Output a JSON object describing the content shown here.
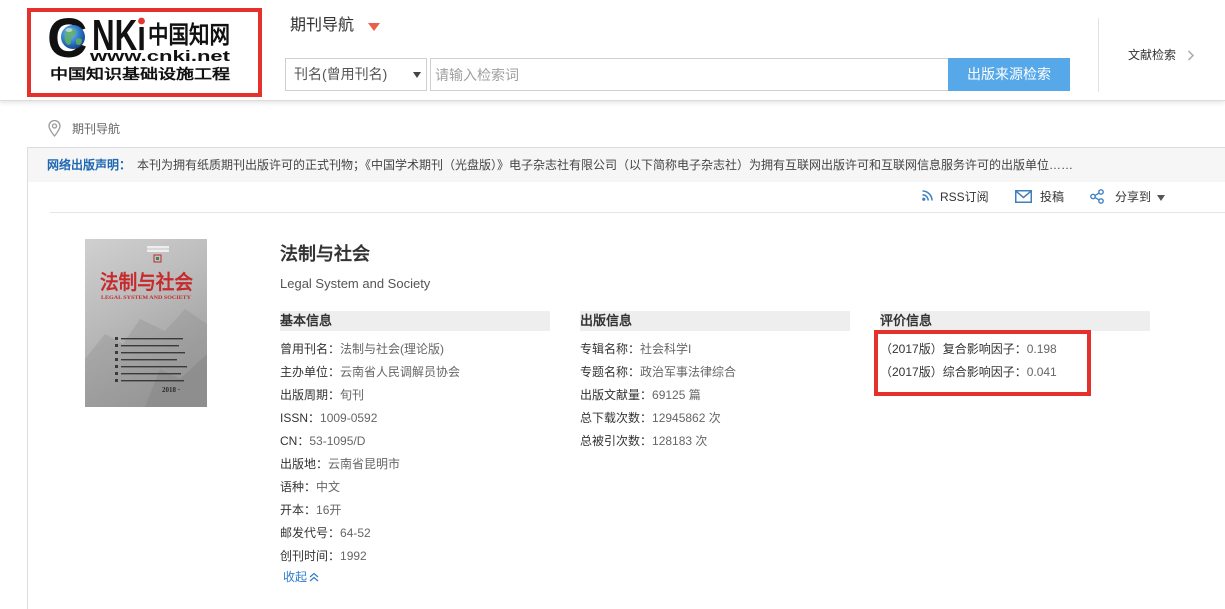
{
  "theme": {
    "search_button_bg": "#57a8e8",
    "highlight_red": "#e4312b",
    "nav_arrow_red": "#ea5f49",
    "notice_label_blue": "#1f68b2",
    "link_blue": "#2d7ccc",
    "icon_blue": "#3f7fc0"
  },
  "header": {
    "logo": {
      "brand_initial": "C",
      "brand_rest": "NKi",
      "brand_cn": "中国知网",
      "url_text": "www.cnki.net",
      "tagline": "中国知识基础设施工程"
    },
    "nav_title": "期刊导航",
    "search": {
      "field_select": "刊名(曾用刊名)",
      "placeholder": "请输入检索词",
      "button": "出版来源检索"
    },
    "right_link": "文献检索"
  },
  "breadcrumb": {
    "current": "期刊导航"
  },
  "notice": {
    "label": "网络出版声明：",
    "text": "本刊为拥有纸质期刊出版许可的正式刊物；《中国学术期刊（光盘版）》电子杂志社有限公司（以下简称电子杂志社）为拥有互联网出版许可和互联网信息服务许可的出版单位……"
  },
  "toolbar": {
    "rss": {
      "label": "RSS订阅",
      "icon": "rss-icon"
    },
    "submit": {
      "label": "投稿",
      "icon": "envelope-icon"
    },
    "share": {
      "label": "分享到",
      "icon": "share-icon"
    }
  },
  "journal": {
    "title": "法制与社会",
    "title_en": "Legal System and Society",
    "cover": {
      "title": "法制与社会",
      "subtitle": "LEGAL SYSTEM AND SOCIETY",
      "issue": "2018 ·"
    }
  },
  "basic_info": {
    "heading": "基本信息",
    "items": [
      {
        "label": "曾用刊名：",
        "value": "法制与社会(理论版)"
      },
      {
        "label": "主办单位：",
        "value": "云南省人民调解员协会"
      },
      {
        "label": "出版周期：",
        "value": "旬刊"
      },
      {
        "label": "ISSN：",
        "value": "1009-0592"
      },
      {
        "label": "CN：",
        "value": "53-1095/D"
      },
      {
        "label": "出版地：",
        "value": "云南省昆明市"
      },
      {
        "label": "语种：",
        "value": "中文"
      },
      {
        "label": "开本：",
        "value": "16开"
      },
      {
        "label": "邮发代号：",
        "value": "64-52"
      },
      {
        "label": "创刊时间：",
        "value": "1992"
      }
    ],
    "collapse_label": "收起"
  },
  "publish_info": {
    "heading": "出版信息",
    "items": [
      {
        "label": "专辑名称：",
        "value": "社会科学I"
      },
      {
        "label": "专题名称：",
        "value": "政治军事法律综合"
      },
      {
        "label": "出版文献量：",
        "value": "69125 篇"
      },
      {
        "label": "总下载次数：",
        "value": "12945862 次"
      },
      {
        "label": "总被引次数：",
        "value": "128183 次"
      }
    ]
  },
  "evaluation_info": {
    "heading": "评价信息",
    "items": [
      {
        "label": "（2017版）复合影响因子：",
        "value": "0.198"
      },
      {
        "label": "（2017版）综合影响因子：",
        "value": "0.041"
      }
    ]
  }
}
